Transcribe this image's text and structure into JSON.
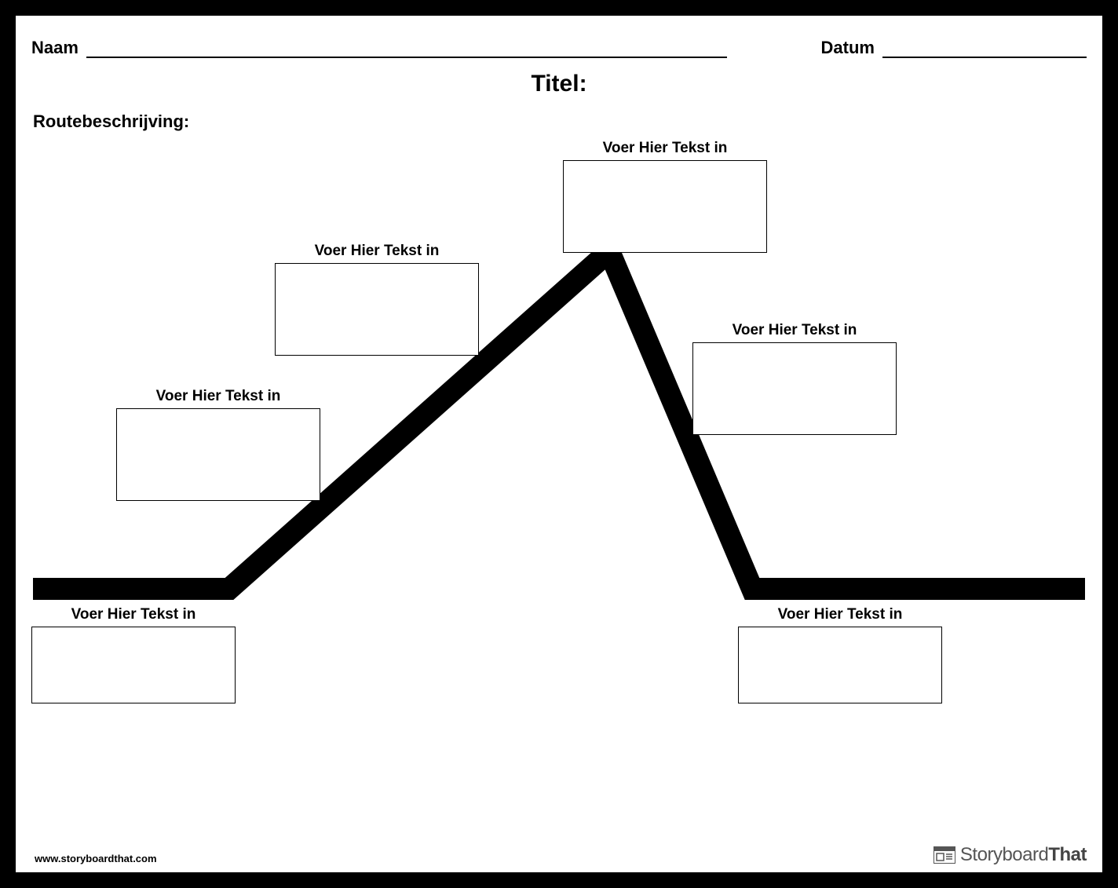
{
  "header": {
    "name_label": "Naam",
    "date_label": "Datum",
    "title_label": "Titel:"
  },
  "directions_label": "Routebeschrijving:",
  "placeholder_text": "Voer Hier Tekst in",
  "boxes": {
    "exposition": {
      "label": "Voer Hier Tekst in"
    },
    "rising1": {
      "label": "Voer Hier Tekst in"
    },
    "rising2": {
      "label": "Voer Hier Tekst in"
    },
    "climax": {
      "label": "Voer Hier Tekst in"
    },
    "falling": {
      "label": "Voer Hier Tekst in"
    },
    "resolution": {
      "label": "Voer Hier Tekst in"
    }
  },
  "footer": {
    "url": "www.storyboardthat.com",
    "brand_a": "Storyboard",
    "brand_b": "That"
  }
}
